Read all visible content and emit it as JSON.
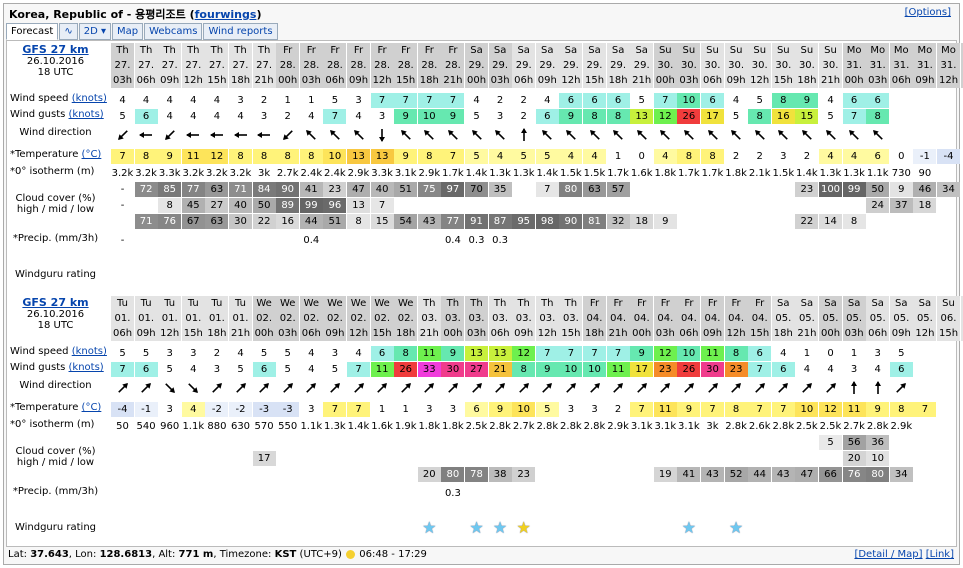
{
  "title": {
    "place": "Korea, Republic of - 용평리조트",
    "user": "fourwings"
  },
  "options_label": "[Options]",
  "tabs": [
    "Forecast",
    "∿",
    "2D ▾",
    "Map",
    "Webcams",
    "Wind reports"
  ],
  "labels": {
    "wind_speed": "Wind speed",
    "wind_gusts": "Wind gusts",
    "knots": "(knots)",
    "wind_direction": "Wind direction",
    "temperature": "*Temperature",
    "celsius": "(°C)",
    "isotherm": "*0° isotherm (m)",
    "cloud1": "Cloud cover (%)",
    "cloud2": "high / mid / low",
    "precip": "*Precip. (mm/3h)",
    "rating": "Windguru rating"
  },
  "blocks": [
    {
      "model": "GFS 27 km",
      "date": "26.10.2016",
      "utc": "18 UTC",
      "days": [
        "Th",
        "Th",
        "Th",
        "Th",
        "Th",
        "Th",
        "Th",
        "Fr",
        "Fr",
        "Fr",
        "Fr",
        "Fr",
        "Fr",
        "Fr",
        "Fr",
        "Sa",
        "Sa",
        "Sa",
        "Sa",
        "Sa",
        "Sa",
        "Sa",
        "Sa",
        "Su",
        "Su",
        "Su",
        "Su",
        "Su",
        "Su",
        "Su",
        "Su",
        "Mo",
        "Mo",
        "Mo",
        "Mo",
        "Mo",
        "Mo",
        "We"
      ],
      "dates": [
        "27.",
        "27.",
        "27.",
        "27.",
        "27.",
        "27.",
        "27.",
        "28.",
        "28.",
        "28.",
        "28.",
        "28.",
        "28.",
        "28.",
        "28.",
        "29.",
        "29.",
        "29.",
        "29.",
        "29.",
        "29.",
        "29.",
        "29.",
        "30.",
        "30.",
        "30.",
        "30.",
        "30.",
        "30.",
        "30.",
        "30.",
        "31.",
        "31.",
        "31.",
        "31.",
        "31.",
        "31.",
        "01."
      ],
      "hours": [
        "03h",
        "06h",
        "09h",
        "12h",
        "15h",
        "18h",
        "21h",
        "00h",
        "03h",
        "06h",
        "09h",
        "12h",
        "15h",
        "18h",
        "21h",
        "00h",
        "03h",
        "06h",
        "09h",
        "12h",
        "15h",
        "18h",
        "21h",
        "00h",
        "03h",
        "06h",
        "09h",
        "12h",
        "15h",
        "18h",
        "21h",
        "00h",
        "03h",
        "06h",
        "09h",
        "12h",
        "15h",
        "18h",
        "21h",
        "00h"
      ],
      "wind": [
        "4",
        "4",
        "4",
        "4",
        "4",
        "3",
        "2",
        "1",
        "1",
        "5",
        "3",
        "7",
        "7",
        "7",
        "7",
        "4",
        "2",
        "2",
        "4",
        "6",
        "6",
        "6",
        "5",
        "7",
        "10",
        "6",
        "4",
        "5",
        "8",
        "9",
        "4",
        "6",
        "6",
        "",
        "",
        "",
        "",
        ""
      ],
      "gusts": [
        "5",
        "6",
        "4",
        "4",
        "4",
        "4",
        "3",
        "2",
        "4",
        "7",
        "4",
        "3",
        "9",
        "10",
        "9",
        "5",
        "3",
        "2",
        "6",
        "9",
        "8",
        "8",
        "13",
        "12",
        "26",
        "17",
        "5",
        "8",
        "16",
        "15",
        "5",
        "7",
        "8",
        "",
        "",
        "",
        "",
        ""
      ],
      "dirs": [
        225,
        270,
        225,
        270,
        270,
        270,
        270,
        225,
        315,
        315,
        315,
        180,
        315,
        315,
        315,
        315,
        315,
        0,
        315,
        315,
        315,
        315,
        315,
        315,
        315,
        315,
        315,
        315,
        315,
        315,
        315,
        315,
        315,
        0,
        0,
        0,
        0,
        0
      ],
      "temp": [
        "7",
        "8",
        "9",
        "11",
        "12",
        "8",
        "8",
        "8",
        "8",
        "10",
        "13",
        "13",
        "9",
        "8",
        "7",
        "5",
        "4",
        "5",
        "5",
        "4",
        "4",
        "1",
        "0",
        "4",
        "8",
        "8",
        "2",
        "2",
        "3",
        "2",
        "4",
        "4",
        "6",
        "0",
        "-1",
        "-4",
        "",
        ""
      ],
      "iso": [
        "3.2k",
        "3.2k",
        "3.3k",
        "3.2k",
        "3.2k",
        "3.2k",
        "3k",
        "2.7k",
        "2.4k",
        "2.4k",
        "2.9k",
        "3.3k",
        "3.1k",
        "2.9k",
        "1.7k",
        "1.4k",
        "1.3k",
        "1.3k",
        "1.4k",
        "1.5k",
        "1.5k",
        "1.7k",
        "1.6k",
        "1.8k",
        "1.7k",
        "1.7k",
        "1.8k",
        "2.1k",
        "1.5k",
        "1.4k",
        "1.3k",
        "1.3k",
        "1.1k",
        "730",
        "90",
        "",
        "",
        ""
      ],
      "cloud_high": [
        "-",
        "72",
        "85",
        "77",
        "63",
        "71",
        "84",
        "90",
        "41",
        "23",
        "47",
        "40",
        "51",
        "75",
        "97",
        "70",
        "35",
        "",
        "7",
        "80",
        "63",
        "57",
        "",
        "",
        "",
        "",
        "",
        "",
        "",
        "23",
        "100",
        "99",
        "50",
        "9",
        "46",
        "34",
        "",
        ""
      ],
      "cloud_mid": [
        "-",
        "",
        "8",
        "45",
        "27",
        "40",
        "50",
        "89",
        "99",
        "96",
        "13",
        "7",
        "",
        "",
        "",
        "",
        "",
        "",
        "",
        "",
        "",
        "",
        "",
        "",
        "",
        "",
        "",
        "",
        "",
        "",
        "",
        "",
        "24",
        "37",
        "18",
        "",
        "",
        ""
      ],
      "cloud_low": [
        "",
        "71",
        "76",
        "67",
        "63",
        "30",
        "22",
        "16",
        "44",
        "51",
        "8",
        "15",
        "54",
        "43",
        "77",
        "91",
        "87",
        "95",
        "98",
        "90",
        "81",
        "32",
        "18",
        "9",
        "",
        "",
        "",
        "",
        "",
        "22",
        "14",
        "8",
        "",
        "",
        "",
        "",
        "",
        ""
      ],
      "precip": [
        "-",
        "",
        "",
        "",
        "",
        "",
        "",
        "",
        "0.4",
        "",
        "",
        "",
        "",
        "",
        "0.4",
        "0.3",
        "0.3",
        "",
        "",
        "",
        "",
        "",
        "",
        "",
        "",
        "",
        "",
        "",
        "",
        "",
        "",
        "",
        "",
        "",
        "",
        "",
        "",
        ""
      ],
      "rating": [
        "",
        "",
        "",
        "",
        "",
        "",
        "",
        "",
        "",
        "",
        "",
        "",
        "",
        "",
        "",
        "",
        "",
        "",
        "",
        "",
        "",
        "",
        "",
        "",
        "",
        "",
        "",
        "",
        "",
        "",
        "",
        "",
        "",
        "",
        "",
        "",
        "",
        ""
      ]
    },
    {
      "model": "GFS 27 km",
      "date": "26.10.2016",
      "utc": "18 UTC",
      "days": [
        "Tu",
        "Tu",
        "Tu",
        "Tu",
        "Tu",
        "Tu",
        "We",
        "We",
        "We",
        "We",
        "We",
        "We",
        "We",
        "Th",
        "Th",
        "Th",
        "Th",
        "Th",
        "Th",
        "Th",
        "Fr",
        "Fr",
        "Fr",
        "Fr",
        "Fr",
        "Fr",
        "Fr",
        "Fr",
        "Sa",
        "Sa",
        "Sa",
        "Sa",
        "Sa",
        "Sa",
        "Sa",
        "Su",
        "Su",
        "Su"
      ],
      "dates": [
        "01.",
        "01.",
        "01.",
        "01.",
        "01.",
        "01.",
        "02.",
        "02.",
        "02.",
        "02.",
        "02.",
        "02.",
        "02.",
        "03.",
        "03.",
        "03.",
        "03.",
        "03.",
        "03.",
        "03.",
        "04.",
        "04.",
        "04.",
        "04.",
        "04.",
        "04.",
        "04.",
        "04.",
        "05.",
        "05.",
        "05.",
        "05.",
        "05.",
        "05.",
        "05.",
        "06.",
        "06.",
        "06."
      ],
      "hours": [
        "06h",
        "09h",
        "12h",
        "15h",
        "18h",
        "21h",
        "00h",
        "03h",
        "06h",
        "09h",
        "12h",
        "15h",
        "18h",
        "21h",
        "00h",
        "03h",
        "06h",
        "09h",
        "12h",
        "15h",
        "18h",
        "21h",
        "00h",
        "03h",
        "06h",
        "09h",
        "12h",
        "15h",
        "18h",
        "21h",
        "00h",
        "03h",
        "06h",
        "09h",
        "12h",
        "15h",
        "18h",
        "21h"
      ],
      "wind": [
        "5",
        "5",
        "3",
        "3",
        "2",
        "4",
        "5",
        "5",
        "4",
        "3",
        "4",
        "6",
        "8",
        "11",
        "9",
        "13",
        "13",
        "12",
        "7",
        "7",
        "7",
        "7",
        "9",
        "12",
        "10",
        "11",
        "8",
        "6",
        "4",
        "1",
        "0",
        "1",
        "3",
        "5",
        "",
        "",
        "",
        ""
      ],
      "gusts": [
        "7",
        "6",
        "5",
        "4",
        "3",
        "5",
        "6",
        "5",
        "4",
        "5",
        "7",
        "11",
        "26",
        "33",
        "30",
        "27",
        "21",
        "8",
        "9",
        "10",
        "10",
        "11",
        "17",
        "23",
        "26",
        "30",
        "23",
        "7",
        "6",
        "4",
        "4",
        "3",
        "4",
        "6",
        "",
        "",
        "",
        ""
      ],
      "dirs": [
        45,
        45,
        135,
        135,
        45,
        45,
        45,
        45,
        45,
        45,
        45,
        45,
        45,
        45,
        45,
        45,
        45,
        45,
        45,
        45,
        45,
        45,
        45,
        45,
        45,
        45,
        45,
        45,
        45,
        45,
        45,
        0,
        0,
        45,
        0,
        0,
        0,
        0
      ],
      "temp": [
        "-4",
        "-1",
        "3",
        "4",
        "-2",
        "-2",
        "-3",
        "-3",
        "3",
        "7",
        "7",
        "1",
        "1",
        "3",
        "3",
        "6",
        "9",
        "10",
        "5",
        "3",
        "3",
        "2",
        "7",
        "11",
        "9",
        "7",
        "8",
        "7",
        "7",
        "10",
        "12",
        "11",
        "9",
        "8",
        "7",
        "",
        "",
        ""
      ],
      "iso": [
        "50",
        "540",
        "960",
        "1.1k",
        "880",
        "630",
        "570",
        "550",
        "1.1k",
        "1.3k",
        "1.4k",
        "1.6k",
        "1.9k",
        "1.8k",
        "1.8k",
        "2.5k",
        "2.8k",
        "2.7k",
        "2.8k",
        "2.8k",
        "2.8k",
        "2.9k",
        "3.1k",
        "3.1k",
        "3.1k",
        "3k",
        "2.8k",
        "2.6k",
        "2.8k",
        "2.5k",
        "2.5k",
        "2.7k",
        "2.8k",
        "2.9k",
        "",
        "",
        "",
        ""
      ],
      "cloud_high": [
        "",
        "",
        "",
        "",
        "",
        "",
        "",
        "",
        "",
        "",
        "",
        "",
        "",
        "",
        "",
        "",
        "",
        "",
        "",
        "",
        "",
        "",
        "",
        "",
        "",
        "",
        "",
        "",
        "",
        "",
        "5",
        "56",
        "36",
        "",
        "",
        "",
        "",
        ""
      ],
      "cloud_mid": [
        "",
        "",
        "",
        "",
        "",
        "",
        "17",
        "",
        "",
        "",
        "",
        "",
        "",
        "",
        "",
        "",
        "",
        "",
        "",
        "",
        "",
        "",
        "",
        "",
        "",
        "",
        "",
        "",
        "",
        "",
        "",
        "20",
        "10",
        "",
        "",
        "",
        "",
        ""
      ],
      "cloud_low": [
        "",
        "",
        "",
        "",
        "",
        "",
        "",
        "",
        "",
        "",
        "",
        "",
        "",
        "20",
        "80",
        "78",
        "38",
        "23",
        "",
        "",
        "",
        "",
        "",
        "19",
        "41",
        "43",
        "52",
        "44",
        "43",
        "47",
        "66",
        "76",
        "80",
        "34",
        "",
        "",
        "",
        ""
      ],
      "precip": [
        "",
        "",
        "",
        "",
        "",
        "",
        "",
        "",
        "",
        "",
        "",
        "",
        "",
        "",
        "0.3",
        "",
        "",
        "",
        "",
        "",
        "",
        "",
        "",
        "",
        "",
        "",
        "",
        "",
        "",
        "",
        "",
        "",
        "",
        "",
        "",
        "",
        "",
        ""
      ],
      "rating": [
        "",
        "",
        "",
        "",
        "",
        "",
        "",
        "",
        "",
        "",
        "",
        "",
        "",
        "1",
        "",
        "1",
        "1",
        "2",
        "",
        "",
        "",
        "",
        "",
        "",
        "1",
        "",
        "1",
        "",
        "",
        "",
        "",
        "",
        "",
        "",
        "",
        "",
        "",
        ""
      ]
    }
  ],
  "footer": {
    "lat_label": "Lat:",
    "lat": "37.643",
    "lon_label": "Lon:",
    "lon": "128.6813",
    "alt_label": "Alt:",
    "alt": "771 m",
    "tz_label": "Timezone:",
    "tz": "KST",
    "tz_offset": "(UTC+9)",
    "sun": "06:48 - 17:29",
    "detail": "[Detail / Map]",
    "link": "[Link]"
  }
}
